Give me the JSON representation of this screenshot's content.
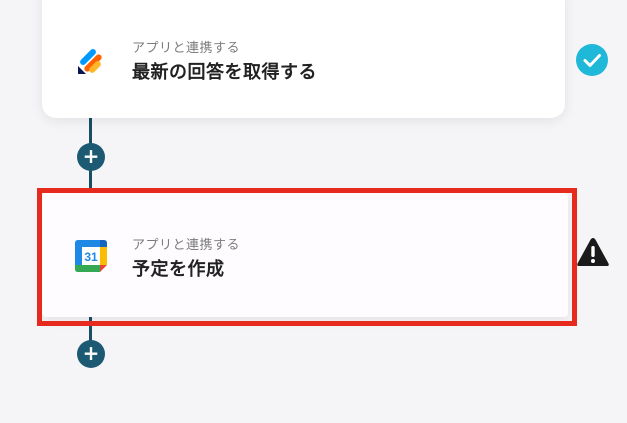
{
  "steps": [
    {
      "subtitle": "アプリと連携する",
      "title": "最新の回答を取得する",
      "app_icon": "jotform-icon",
      "status": "complete",
      "status_icon": "check-circle-icon",
      "status_color": "#1fb8d9"
    },
    {
      "subtitle": "アプリと連携する",
      "title": "予定を作成",
      "app_icon": "google-calendar-icon",
      "calendar_day": "31",
      "status": "warning",
      "status_icon": "warning-triangle-icon",
      "status_color": "#1a1a1a",
      "highlighted": true,
      "highlight_color": "#e62b1e"
    }
  ],
  "add_step_buttons": [
    {
      "label": "+"
    },
    {
      "label": "+"
    }
  ],
  "colors": {
    "background": "#f5f4f7",
    "connector": "#1a4e63",
    "plus_button": "#1c5a73"
  }
}
